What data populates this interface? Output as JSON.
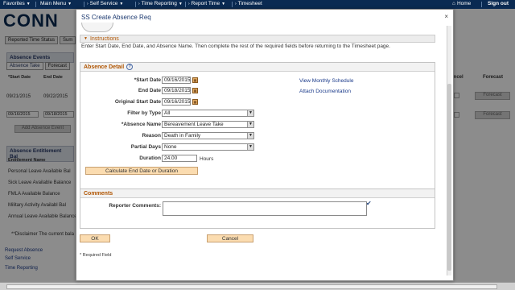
{
  "topnav": {
    "items": [
      "Favorites",
      "Main Menu",
      "Self Service",
      "Time Reporting",
      "Report Time",
      "Timesheet"
    ],
    "home": "Home",
    "signout": "Sign out"
  },
  "background": {
    "logo": "CONN",
    "tabs": [
      "Reported Time Status",
      "Sum"
    ],
    "absence_events": "Absence Events",
    "absence_take_tab": "Absence Take",
    "forecast_tab": "Forecast",
    "start_date_col": "*Start Date",
    "end_date_col": "End Date",
    "cancel_col": "Cancel",
    "forecast_col": "Forecast",
    "row1_start": "09/21/2015",
    "row1_end": "09/22/2015",
    "row2_start": "09/16/2015",
    "row2_end": "09/18/2015",
    "forecast_btn": "Forecast",
    "add_absence_btn": "Add Absence Event",
    "entitlement_header": "Absence Entitlement Bal",
    "entitlement_col": "Entitlement Name",
    "entitlements": [
      "Personal Leave Available Bal",
      "Sick Leave Available Balance",
      "FMLA Available Balance",
      "Military Activity Availabl Bal",
      "Annual Leave Available Balance"
    ],
    "disclaimer": "**Disclaimer  The current bala",
    "links": [
      "Request Absence",
      "Self Service",
      "Time Reporting"
    ]
  },
  "modal": {
    "title": "SS Create Absence Req",
    "close": "×",
    "instructions_header": "Instructions",
    "instructions_text": "Enter Start Date, End Date, and Absence Name. Then complete the rest of the required fields before returning to the Timesheet page.",
    "absence_detail_header": "Absence Detail",
    "help": "?",
    "fields": {
      "start_date_label": "*Start Date",
      "start_date_value": "09/16/2015",
      "end_date_label": "End Date",
      "end_date_value": "09/18/2015",
      "orig_start_label": "Original Start Date",
      "orig_start_value": "09/16/2015",
      "filter_label": "Filter by Type",
      "filter_value": "All",
      "absence_name_label": "*Absence Name",
      "absence_name_value": "Bereavement Leave Take",
      "reason_label": "Reason",
      "reason_value": "Death in Family",
      "partial_label": "Partial Days",
      "partial_value": "None",
      "duration_label": "Duration",
      "duration_value": "24.00",
      "hours": "Hours"
    },
    "calc_button": "Calculate End Date or Duration",
    "view_schedule": "View Monthly Schedule",
    "attach_doc": "Attach Documentation",
    "comments_header": "Comments",
    "reporter_label": "Reporter Comments:",
    "reporter_value": "",
    "ok": "OK",
    "cancel": "Cancel",
    "required_note": "* Required Field"
  }
}
